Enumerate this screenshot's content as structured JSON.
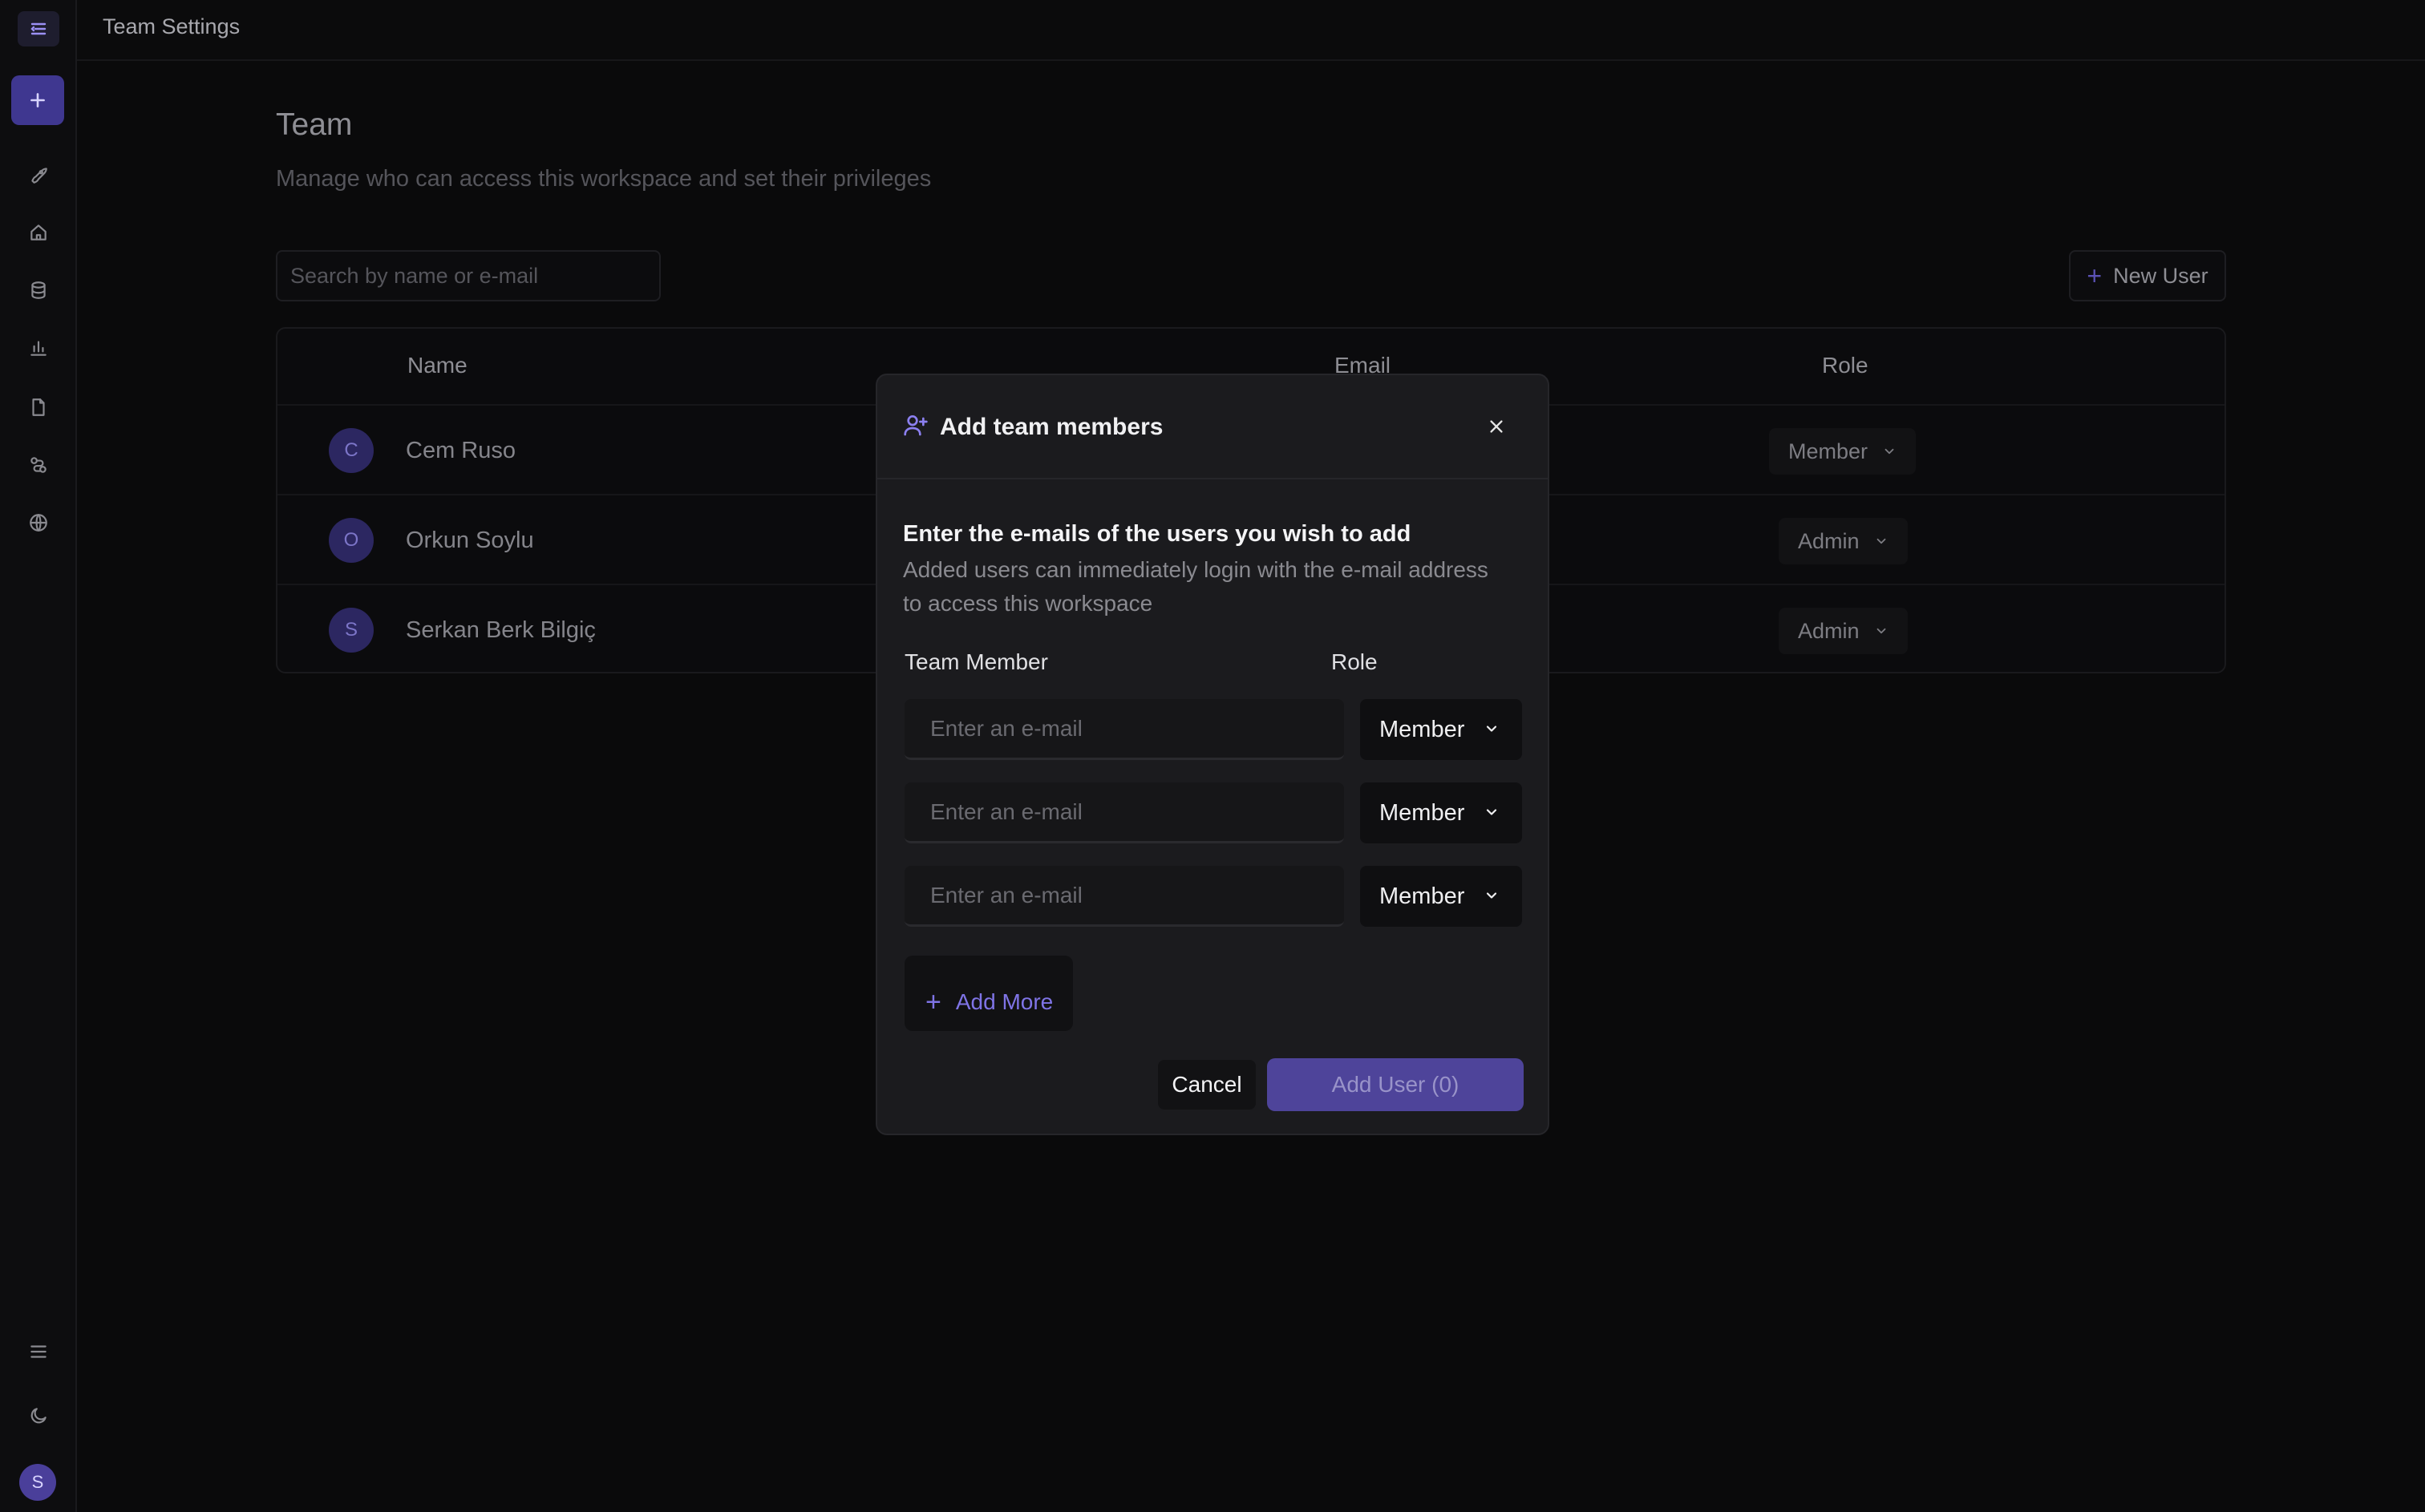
{
  "app": {
    "header_title": "Team Settings"
  },
  "sidebar": {
    "icons": [
      "menu-collapse-icon",
      "plus-icon",
      "rocket-icon",
      "home-icon",
      "database-icon",
      "chart-icon",
      "document-icon",
      "connections-icon",
      "globe-icon",
      "hamburger-icon",
      "moon-icon"
    ],
    "user_initial": "S"
  },
  "page": {
    "title": "Team",
    "subtitle": "Manage who can access this workspace and set their privileges",
    "search_placeholder": "Search by name or e-mail",
    "new_user_label": "New User"
  },
  "table": {
    "headers": {
      "name": "Name",
      "email": "Email",
      "role": "Role"
    },
    "rows": [
      {
        "initial": "C",
        "name": "Cem Ruso",
        "role": "Member"
      },
      {
        "initial": "O",
        "name": "Orkun Soylu",
        "role": "Admin"
      },
      {
        "initial": "S",
        "name": "Serkan Berk Bilgiç",
        "role": "Admin"
      }
    ]
  },
  "modal": {
    "title": "Add team members",
    "heading": "Enter the e-mails of the users you wish to add",
    "description": "Added users can immediately login with the e-mail address to access this workspace",
    "col_member": "Team Member",
    "col_role": "Role",
    "entries": [
      {
        "placeholder": "Enter an e-mail",
        "role": "Member"
      },
      {
        "placeholder": "Enter an e-mail",
        "role": "Member"
      },
      {
        "placeholder": "Enter an e-mail",
        "role": "Member"
      }
    ],
    "add_more_label": "Add More",
    "cancel_label": "Cancel",
    "submit_label": "Add User (0)"
  },
  "colors": {
    "accent": "#4e449a",
    "accent_text": "#7f74e6",
    "background": "#0a0a0b"
  }
}
